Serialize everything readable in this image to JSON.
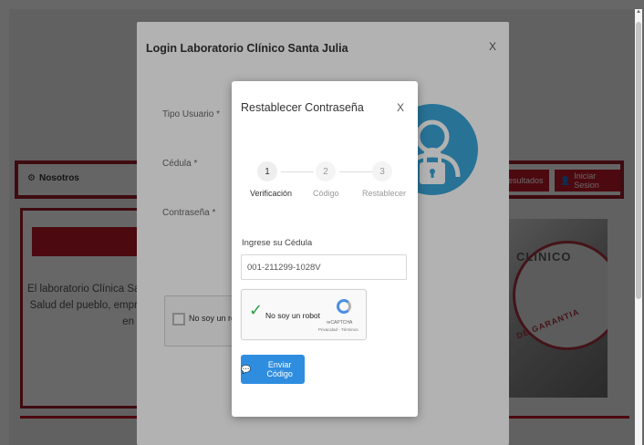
{
  "background": {
    "nav": {
      "left_label": "Nosotros",
      "results_label": "resultados",
      "login_label": "Iniciar Sesion"
    },
    "about_lines": [
      "El laboratorio Clínica Sant",
      "Salud del pueblo, empres",
      "en un"
    ],
    "image_text": "CLINICO",
    "image_subtext": "DE GARANTIA"
  },
  "login_modal": {
    "title": "Login Laboratorio Clínico Santa Julia",
    "close": "X",
    "fields": {
      "tipo_usuario": "Tipo Usuario *",
      "cedula": "Cédula *",
      "contrasena": "Contraseña *"
    },
    "captcha_label": "No soy un robot"
  },
  "reset_modal": {
    "title": "Restablecer Contraseña",
    "close": "X",
    "steps": [
      {
        "number": "1",
        "label": "Verificación"
      },
      {
        "number": "2",
        "label": "Código"
      },
      {
        "number": "3",
        "label": "Restablecer"
      }
    ],
    "input_label": "Ingrese su Cédula",
    "input_value": "001-211299-1028V",
    "recaptcha": {
      "label": "No soy un robot",
      "brand": "reCAPTCHA",
      "terms": "Privacidad - Términos"
    },
    "send_button": "Enviar Código"
  },
  "colors": {
    "brand_red": "#c0182a",
    "accent_blue": "#2f8de0",
    "avatar_blue": "#3aa4d6"
  }
}
